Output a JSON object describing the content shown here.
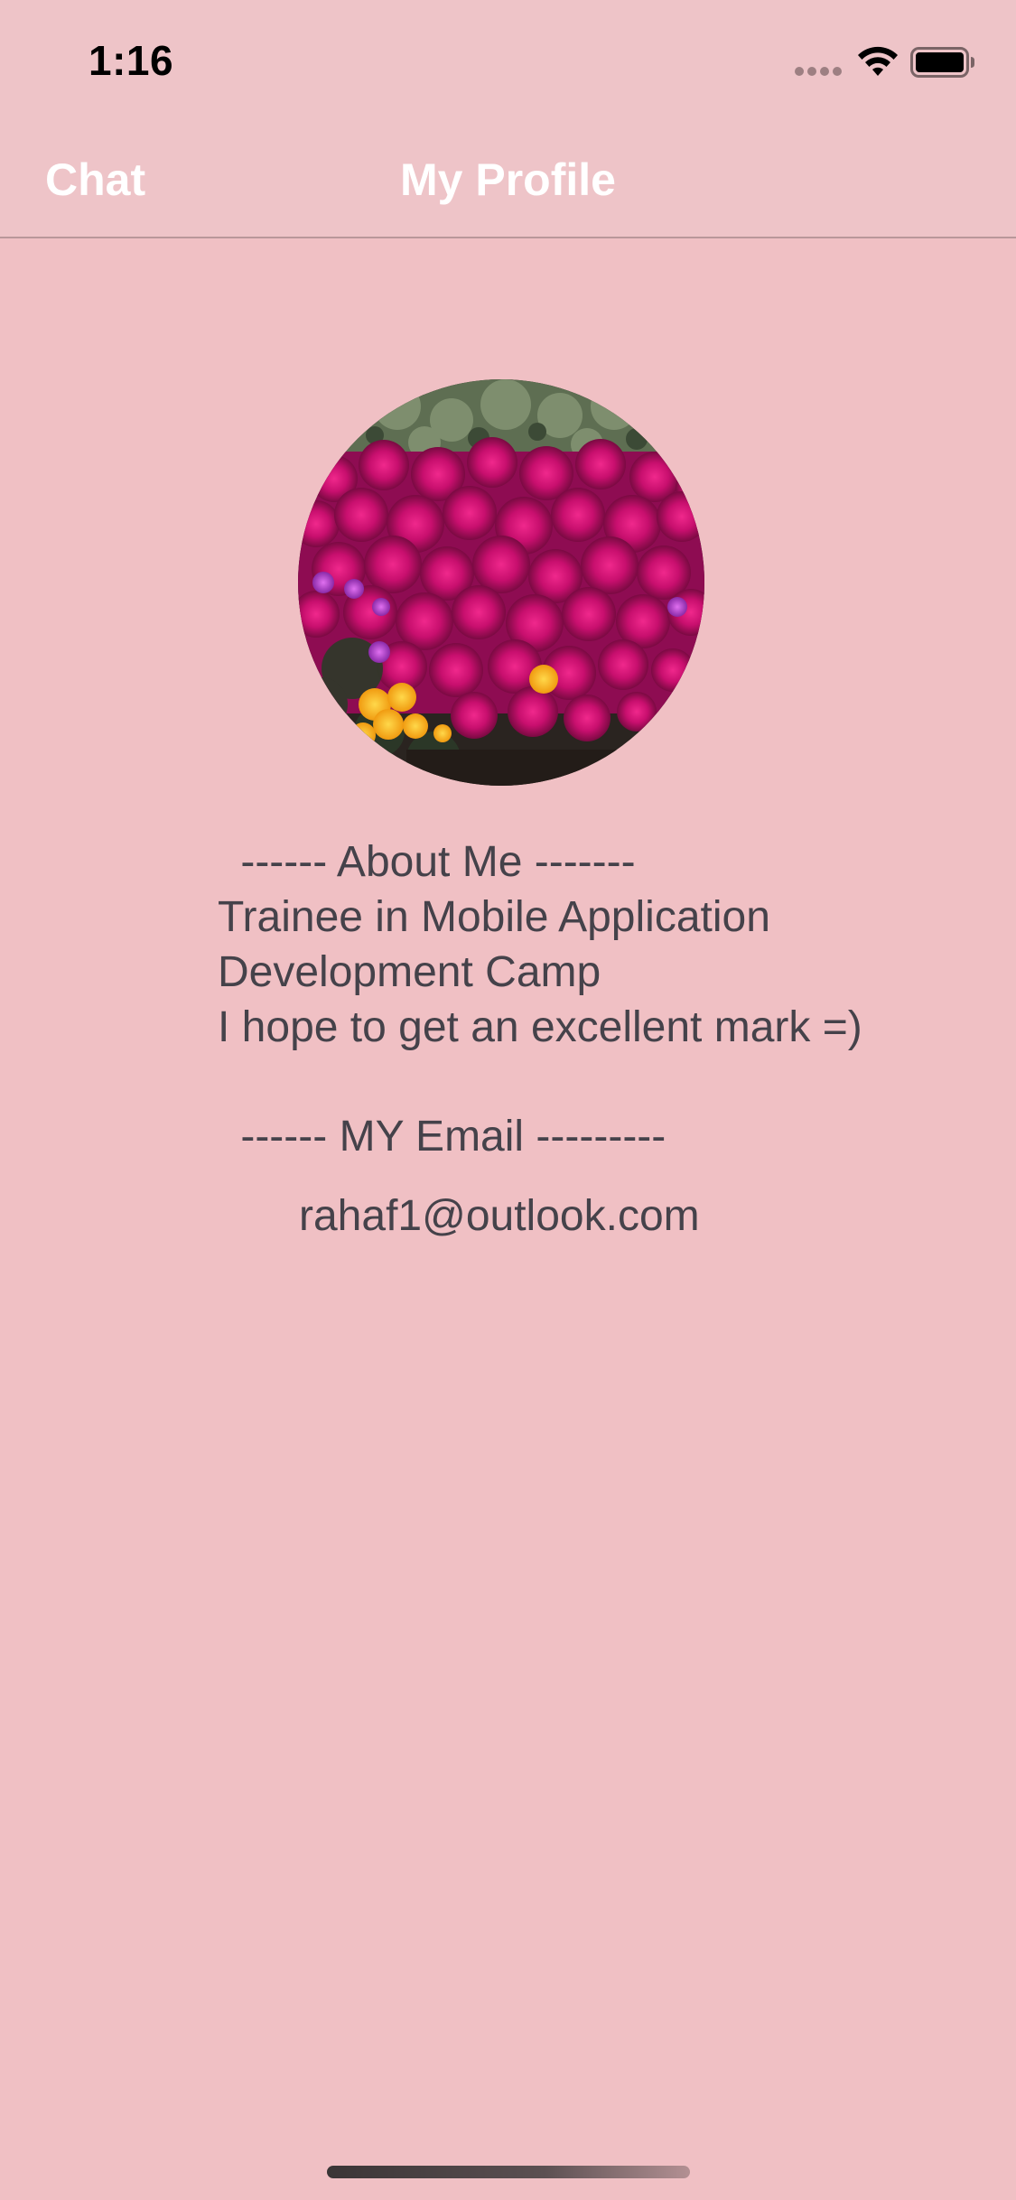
{
  "status_bar": {
    "time": "1:16",
    "signal_icon": "cellular-dots-icon",
    "wifi_icon": "wifi-icon",
    "battery_icon": "battery-icon"
  },
  "nav": {
    "back_label": "Chat",
    "title": "My Profile"
  },
  "profile": {
    "avatar_icon": "flower-photo-avatar",
    "about_heading": " ------ About Me -------",
    "about_lines": [
      "Trainee in Mobile Application",
      "Development Camp",
      "I hope to get an excellent mark =)"
    ],
    "email_heading": " ------ MY Email ---------",
    "email": "rahaf1@outlook.com"
  },
  "colors": {
    "background": "#f0c0c4",
    "bar_background": "#eec4c8",
    "nav_text": "#ffffff",
    "body_text": "#45424a"
  }
}
